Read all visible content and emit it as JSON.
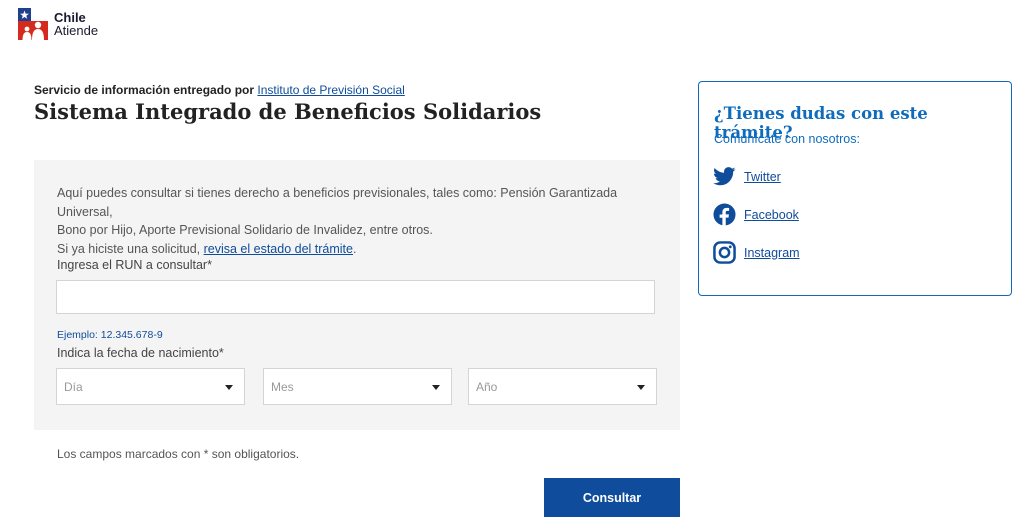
{
  "brand": {
    "line1": "Chile",
    "line2": "Atiende"
  },
  "header": {
    "provider_text": "Servicio de información entregado por",
    "provider_link": "Instituto de Previsión Social",
    "title": "Sistema Integrado de Beneficios Solidarios"
  },
  "form": {
    "description_line1": "Aquí puedes consultar si tienes derecho a beneficios previsionales, tales como: Pensión Garantizada Universal,",
    "description_line2": "Bono por Hijo, Aporte Previsional Solidario de Invalidez, entre otros.",
    "description_line3_pre": "Si ya hiciste una solicitud, ",
    "description_link": "revisa el estado del trámite",
    "description_line3_post": ".",
    "run_label": "Ingresa el RUN a consultar*",
    "run_value": "",
    "run_example": "Ejemplo: 12.345.678-9",
    "date_label": "Indica la fecha de nacimiento*",
    "day_placeholder": "Día",
    "month_placeholder": "Mes",
    "year_placeholder": "Año"
  },
  "required_note": "Los campos marcados con * son obligatorios.",
  "submit_label": "Consultar",
  "sidebar": {
    "title": "¿Tienes dudas con este trámite?",
    "subtitle": "Comunícate con nosotros:",
    "links": [
      {
        "label": "Twitter",
        "icon": "twitter-icon"
      },
      {
        "label": "Facebook",
        "icon": "facebook-icon"
      },
      {
        "label": "Instagram",
        "icon": "instagram-icon"
      }
    ]
  },
  "colors": {
    "primary": "#0f4c9b",
    "accent": "#0f6cbd",
    "panel": "#f4f4f4"
  }
}
